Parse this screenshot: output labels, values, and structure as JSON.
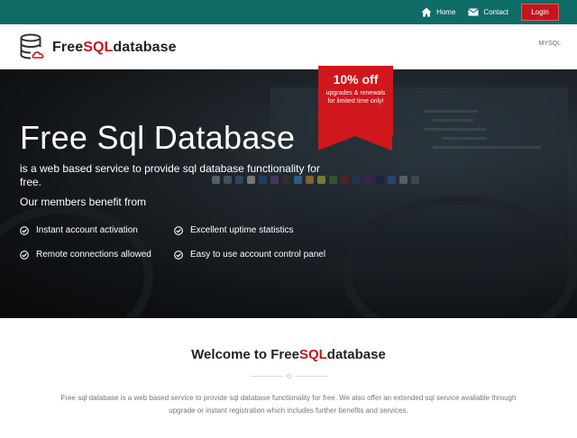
{
  "topbar": {
    "home_label": "Home",
    "contact_label": "Contact",
    "login_label": "Login"
  },
  "header": {
    "logo_prefix": "Free",
    "logo_accent": "SQL",
    "logo_suffix": "database",
    "nav_mysql": "MYSQL"
  },
  "hero": {
    "title": "Free Sql Database",
    "subtitle": "is a web based service to provide sql database functionality for free.",
    "benefit_heading": "Our members benefit from",
    "features": [
      "Instant account activation",
      "Excellent uptime statistics",
      "Remote connections allowed",
      "Easy to use account control panel"
    ]
  },
  "promo": {
    "title": "10% off",
    "description": "upgrades & renewals for limited time only!"
  },
  "welcome": {
    "title_prefix": "Welcome to ",
    "title_brand_a": "Free",
    "title_brand_accent": "SQL",
    "title_brand_b": "database",
    "text": "Free sql database is a web based service to provide sql database functionality for free. We also offer an extended sql service available through upgrade or instant registration which includes further benefits and services."
  },
  "colors": {
    "topbar": "#0f6b66",
    "accent_red": "#c4161c"
  },
  "icons": [
    "home-icon",
    "envelope-icon",
    "database-cloud-icon",
    "check-circle-icon"
  ]
}
